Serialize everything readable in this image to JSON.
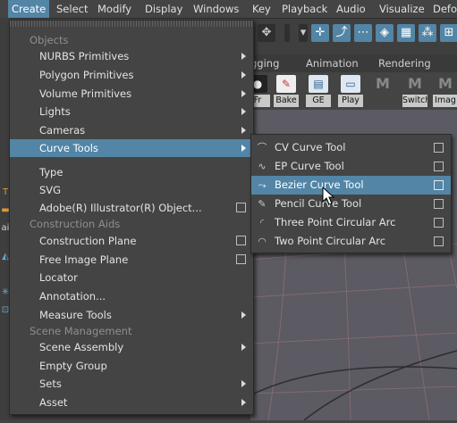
{
  "menubar": {
    "items": [
      {
        "label": "Create",
        "active": true
      },
      {
        "label": "Select"
      },
      {
        "label": "Modify"
      },
      {
        "label": "Display"
      },
      {
        "label": "Windows"
      },
      {
        "label": "Key"
      },
      {
        "label": "Playback"
      },
      {
        "label": "Audio"
      },
      {
        "label": "Visualize"
      },
      {
        "label": "Defo"
      }
    ]
  },
  "shelf_tabs": [
    "gging",
    "Animation",
    "Rendering"
  ],
  "shelf_icons": [
    {
      "label": "Fr",
      "icon": "keyframe-icon"
    },
    {
      "label": "Bake",
      "icon": "bake-icon"
    },
    {
      "label": "GE",
      "icon": "graph-editor-icon"
    },
    {
      "label": "Play",
      "icon": "play-icon"
    },
    {
      "label": "",
      "icon": "maya-m-icon"
    },
    {
      "label": "SwitchF",
      "icon": "switch-icon"
    },
    {
      "label": "Imag",
      "icon": "image-icon"
    }
  ],
  "create_menu": {
    "sections": {
      "objects": "Objects",
      "construction_aids": "Construction Aids",
      "scene_management": "Scene Management"
    },
    "items": {
      "nurbs": "NURBS Primitives",
      "polygon": "Polygon Primitives",
      "volume": "Volume Primitives",
      "lights": "Lights",
      "cameras": "Cameras",
      "curve_tools": "Curve Tools",
      "type": "Type",
      "svg": "SVG",
      "illustrator": "Adobe(R) Illustrator(R) Object...",
      "construction_plane": "Construction Plane",
      "free_image_plane": "Free Image Plane",
      "locator": "Locator",
      "annotation": "Annotation...",
      "measure_tools": "Measure Tools",
      "scene_assembly": "Scene Assembly",
      "empty_group": "Empty Group",
      "sets": "Sets",
      "asset": "Asset"
    }
  },
  "curve_tools_submenu": {
    "items": [
      {
        "label": "CV Curve Tool",
        "icon": "cv-curve-icon"
      },
      {
        "label": "EP Curve Tool",
        "icon": "ep-curve-icon"
      },
      {
        "label": "Bezier Curve Tool",
        "icon": "bezier-curve-icon",
        "highlighted": true
      },
      {
        "label": "Pencil Curve Tool",
        "icon": "pencil-curve-icon"
      },
      {
        "label": "Three Point Circular Arc",
        "icon": "three-point-arc-icon"
      },
      {
        "label": "Two Point Circular Arc",
        "icon": "two-point-arc-icon"
      }
    ]
  },
  "colors": {
    "highlight": "#5285a6",
    "menu_bg": "#444444",
    "section_text": "#8f8f8f"
  }
}
